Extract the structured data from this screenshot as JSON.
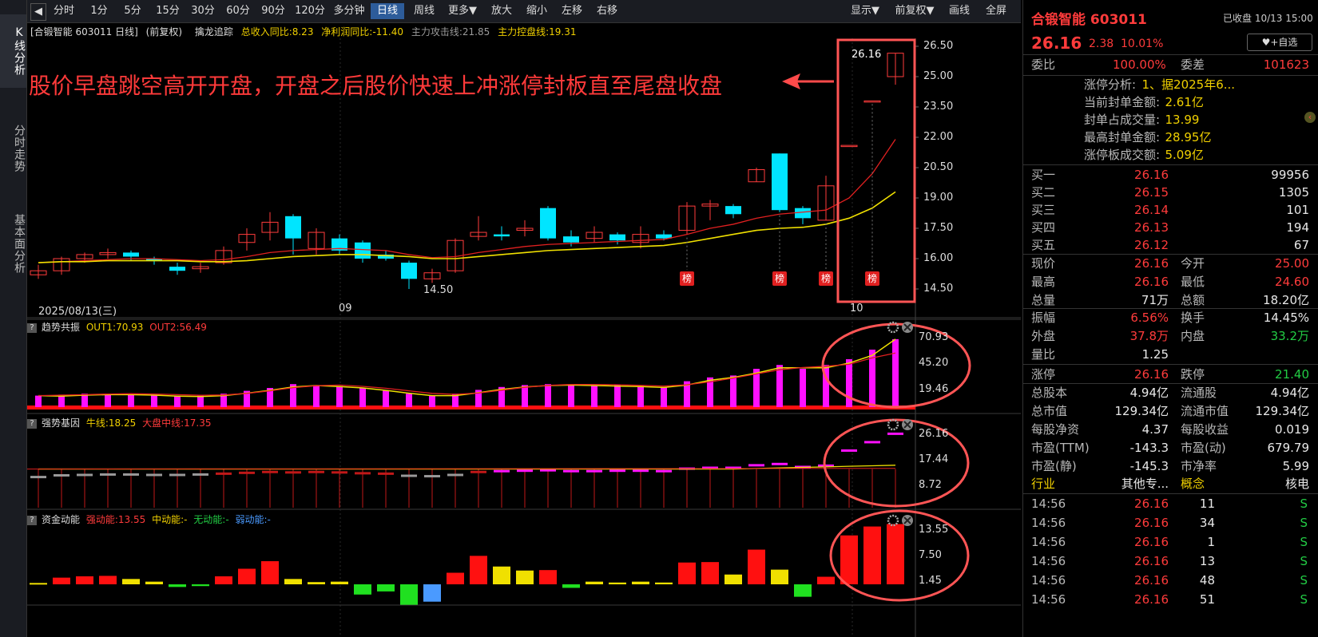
{
  "left_tabs": [
    "K线分析",
    "分时走势",
    "基本面分析"
  ],
  "toolbar": {
    "items": [
      "分时",
      "1分",
      "5分",
      "15分",
      "30分",
      "60分",
      "90分",
      "120分",
      "多分钟",
      "日线",
      "周线",
      "更多▼",
      "放大",
      "缩小",
      "左移",
      "右移"
    ],
    "right_items": [
      "显示▼",
      "前复权▼",
      "画线",
      "全屏"
    ],
    "selected": "日线"
  },
  "info_bar": {
    "title": "[合锻智能 603011 日线]",
    "adj": "(前复权)",
    "indicator": "擒龙追踪",
    "revenue": "总收入同比:8.23",
    "profit": "净利润同比:-11.40",
    "attack": "主力攻击线:21.85",
    "control": "主力控盘线:19.31"
  },
  "annotation": "股价早盘跳空高开开盘，开盘之后股价快速上冲涨停封板直至尾盘收盘",
  "main_chart": {
    "y_ticks": [
      "26.50",
      "25.00",
      "23.50",
      "22.00",
      "20.50",
      "19.00",
      "17.50",
      "16.00",
      "14.50"
    ],
    "last_price_label": "26.16",
    "low_label": "14.50",
    "date_labels": [
      "2025/08/13(三)",
      "09",
      "10"
    ],
    "badge_text": "榜"
  },
  "panel1": {
    "name": "趋势共振",
    "out1": "OUT1:70.93",
    "out2": "OUT2:56.49",
    "ticks": [
      "70.93",
      "45.20",
      "19.46"
    ]
  },
  "panel2": {
    "name": "强势基因",
    "bull": "牛线:18.25",
    "market": "大盘中线:17.35",
    "ticks": [
      "26.16",
      "17.44",
      "8.72"
    ]
  },
  "panel3": {
    "name": "资金动能",
    "strong": "强动能:13.55",
    "mid": "中动能:-",
    "none": "无动能:-",
    "weak": "弱动能:-",
    "ticks": [
      "13.55",
      "7.50",
      "1.45"
    ]
  },
  "chart_data": {
    "type": "candlestick",
    "candles": [
      {
        "o": 15.2,
        "h": 15.7,
        "l": 15.0,
        "c": 15.4
      },
      {
        "o": 15.4,
        "h": 16.1,
        "l": 15.2,
        "c": 16.0
      },
      {
        "o": 16.0,
        "h": 16.3,
        "l": 15.8,
        "c": 16.2
      },
      {
        "o": 16.2,
        "h": 16.5,
        "l": 16.0,
        "c": 16.3
      },
      {
        "o": 16.3,
        "h": 16.4,
        "l": 15.9,
        "c": 16.1
      },
      {
        "o": 16.0,
        "h": 16.1,
        "l": 15.7,
        "c": 15.9
      },
      {
        "o": 15.6,
        "h": 15.8,
        "l": 15.2,
        "c": 15.4
      },
      {
        "o": 15.5,
        "h": 15.8,
        "l": 15.3,
        "c": 15.6
      },
      {
        "o": 15.8,
        "h": 16.6,
        "l": 15.7,
        "c": 16.4
      },
      {
        "o": 16.8,
        "h": 17.5,
        "l": 16.4,
        "c": 17.2
      },
      {
        "o": 17.3,
        "h": 18.3,
        "l": 16.9,
        "c": 17.8
      },
      {
        "o": 18.1,
        "h": 18.2,
        "l": 16.2,
        "c": 17.0
      },
      {
        "o": 16.5,
        "h": 17.5,
        "l": 16.2,
        "c": 17.3
      },
      {
        "o": 17.0,
        "h": 17.2,
        "l": 16.2,
        "c": 16.4
      },
      {
        "o": 16.8,
        "h": 16.9,
        "l": 15.8,
        "c": 16.0
      },
      {
        "o": 16.2,
        "h": 16.4,
        "l": 15.9,
        "c": 16.0
      },
      {
        "o": 15.8,
        "h": 15.9,
        "l": 14.5,
        "c": 15.0
      },
      {
        "o": 15.0,
        "h": 15.5,
        "l": 14.8,
        "c": 15.3
      },
      {
        "o": 15.4,
        "h": 17.0,
        "l": 15.3,
        "c": 16.9
      },
      {
        "o": 17.1,
        "h": 18.1,
        "l": 16.9,
        "c": 17.3
      },
      {
        "o": 17.2,
        "h": 17.6,
        "l": 16.9,
        "c": 17.1
      },
      {
        "o": 17.4,
        "h": 17.9,
        "l": 17.1,
        "c": 17.5
      },
      {
        "o": 18.5,
        "h": 18.6,
        "l": 16.9,
        "c": 17.0
      },
      {
        "o": 17.1,
        "h": 17.4,
        "l": 16.6,
        "c": 16.8
      },
      {
        "o": 17.0,
        "h": 17.6,
        "l": 16.8,
        "c": 17.3
      },
      {
        "o": 17.2,
        "h": 17.3,
        "l": 16.7,
        "c": 16.9
      },
      {
        "o": 16.8,
        "h": 17.6,
        "l": 16.5,
        "c": 17.2
      },
      {
        "o": 17.2,
        "h": 17.4,
        "l": 16.9,
        "c": 17.0
      },
      {
        "o": 17.4,
        "h": 18.8,
        "l": 17.2,
        "c": 18.6
      },
      {
        "o": 18.6,
        "h": 18.9,
        "l": 17.9,
        "c": 18.7
      },
      {
        "o": 18.6,
        "h": 18.7,
        "l": 18.0,
        "c": 18.2
      },
      {
        "o": 19.8,
        "h": 20.5,
        "l": 19.8,
        "c": 20.4
      },
      {
        "o": 21.2,
        "h": 21.2,
        "l": 18.3,
        "c": 18.4
      },
      {
        "o": 18.5,
        "h": 18.6,
        "l": 17.7,
        "c": 18.0
      },
      {
        "o": 17.9,
        "h": 20.1,
        "l": 17.9,
        "c": 19.6
      },
      {
        "o": 21.6,
        "h": 21.6,
        "l": 21.6,
        "c": 21.6
      },
      {
        "o": 23.8,
        "h": 23.8,
        "l": 23.8,
        "c": 23.8
      },
      {
        "o": 25.0,
        "h": 26.16,
        "l": 24.6,
        "c": 26.16
      }
    ],
    "ma_red": [
      15.8,
      15.85,
      15.9,
      15.95,
      16.0,
      16.0,
      15.95,
      15.9,
      15.95,
      16.1,
      16.3,
      16.4,
      16.45,
      16.5,
      16.45,
      16.4,
      16.2,
      16.05,
      16.1,
      16.3,
      16.45,
      16.6,
      16.7,
      16.75,
      16.8,
      16.85,
      16.9,
      16.95,
      17.2,
      17.5,
      17.7,
      18.0,
      18.2,
      18.3,
      18.4,
      19.0,
      20.2,
      21.9
    ],
    "ma_yellow": [
      15.8,
      15.85,
      15.85,
      15.9,
      15.9,
      15.9,
      15.9,
      15.85,
      15.85,
      15.9,
      16.0,
      16.1,
      16.15,
      16.2,
      16.2,
      16.15,
      16.1,
      16.0,
      16.0,
      16.1,
      16.2,
      16.3,
      16.4,
      16.45,
      16.5,
      16.55,
      16.6,
      16.65,
      16.8,
      17.0,
      17.2,
      17.4,
      17.5,
      17.55,
      17.7,
      18.0,
      18.5,
      19.3
    ],
    "trend_bars": [
      12,
      13,
      14,
      14,
      14,
      13,
      12,
      12,
      14,
      17,
      20,
      24,
      23,
      22,
      20,
      17,
      14,
      12,
      14,
      18,
      21,
      23,
      24,
      24,
      23,
      23,
      22,
      21,
      27,
      31,
      33,
      40,
      44,
      40,
      44,
      50,
      60,
      70.93
    ],
    "gene_bars": [
      15.2,
      15.6,
      15.7,
      15.8,
      15.8,
      15.7,
      15.7,
      15.8,
      16.0,
      16.2,
      16.4,
      16.3,
      16.4,
      16.3,
      16.1,
      16.0,
      15.5,
      15.4,
      15.7,
      16.4,
      16.6,
      16.7,
      16.8,
      16.6,
      16.6,
      16.7,
      16.7,
      16.6,
      17.2,
      17.4,
      17.4,
      18.0,
      18.3,
      17.6,
      17.9,
      21.5,
      23.5,
      25.5
    ],
    "fund_bars": [
      0.3,
      1.5,
      1.8,
      1.9,
      1.2,
      0.6,
      -0.6,
      -0.4,
      1.8,
      3.5,
      5.2,
      1.2,
      0.5,
      0.6,
      -2.3,
      -1.6,
      -4.6,
      -3.9,
      2.6,
      6.4,
      4.0,
      3.1,
      3.2,
      -0.8,
      0.6,
      0.4,
      0.6,
      0.4,
      4.9,
      5.0,
      2.2,
      7.8,
      3.3,
      -2.8,
      1.7,
      11.0,
      13.0,
      13.55
    ]
  },
  "right_panel": {
    "stock_name": "合锻智能 603011",
    "status": "已收盘 10/13 15:00",
    "price": "26.16",
    "change": "2.38",
    "change_pct": "10.01%",
    "watch_btn": "♥+自选",
    "weibi_label": "委比",
    "weibi": "100.00%",
    "weicha_label": "委差",
    "weicha": "101623",
    "limit_info": [
      {
        "label": "涨停分析:",
        "value": "1、据2025年6..."
      },
      {
        "label": "当前封单金额:",
        "value": "2.61亿"
      },
      {
        "label": "封单占成交量:",
        "value": "13.99"
      },
      {
        "label": "最高封单金额:",
        "value": "28.95亿"
      },
      {
        "label": "涨停板成交额:",
        "value": "5.09亿"
      }
    ],
    "bids": [
      {
        "label": "买一",
        "price": "26.16",
        "vol": "99956"
      },
      {
        "label": "买二",
        "price": "26.15",
        "vol": "1305"
      },
      {
        "label": "买三",
        "price": "26.14",
        "vol": "101"
      },
      {
        "label": "买四",
        "price": "26.13",
        "vol": "194"
      },
      {
        "label": "买五",
        "price": "26.12",
        "vol": "67"
      }
    ],
    "stats1": [
      {
        "l1": "现价",
        "v1": "26.16",
        "c1": "red",
        "l2": "今开",
        "v2": "25.00",
        "c2": "red"
      },
      {
        "l1": "最高",
        "v1": "26.16",
        "c1": "red",
        "l2": "最低",
        "v2": "24.60",
        "c2": "red"
      },
      {
        "l1": "总量",
        "v1": "71万",
        "c1": "wht",
        "l2": "总额",
        "v2": "18.20亿",
        "c2": "wht"
      }
    ],
    "stats2": [
      {
        "l1": "振幅",
        "v1": "6.56%",
        "c1": "red",
        "l2": "换手",
        "v2": "14.45%",
        "c2": "wht"
      },
      {
        "l1": "外盘",
        "v1": "37.8万",
        "c1": "red",
        "l2": "内盘",
        "v2": "33.2万",
        "c2": "grn"
      },
      {
        "l1": "量比",
        "v1": "1.25",
        "c1": "wht",
        "l2": "",
        "v2": "",
        "c2": "wht"
      }
    ],
    "limit_row": {
      "l1": "涨停",
      "v1": "26.16",
      "l2": "跌停",
      "v2": "21.40"
    },
    "stats3": [
      {
        "l1": "总股本",
        "v1": "4.94亿",
        "l2": "流通股",
        "v2": "4.94亿"
      },
      {
        "l1": "总市值",
        "v1": "129.34亿",
        "l2": "流通市值",
        "v2": "129.34亿"
      },
      {
        "l1": "每股净资",
        "v1": "4.37",
        "l2": "每股收益",
        "v2": "0.019"
      },
      {
        "l1": "市盈(TTM)",
        "v1": "-143.3",
        "l2": "市盈(动)",
        "v2": "679.79"
      },
      {
        "l1": "市盈(静)",
        "v1": "-145.3",
        "l2": "市净率",
        "v2": "5.99"
      }
    ],
    "industry": {
      "l1": "行业",
      "v1": "其他专...",
      "l2": "概念",
      "v2": "核电"
    },
    "ticks": [
      {
        "time": "14:56",
        "price": "26.16",
        "vol": "11",
        "side": "S"
      },
      {
        "time": "14:56",
        "price": "26.16",
        "vol": "34",
        "side": "S"
      },
      {
        "time": "14:56",
        "price": "26.16",
        "vol": "1",
        "side": "S"
      },
      {
        "time": "14:56",
        "price": "26.16",
        "vol": "13",
        "side": "S"
      },
      {
        "time": "14:56",
        "price": "26.16",
        "vol": "48",
        "side": "S"
      },
      {
        "time": "14:56",
        "price": "26.16",
        "vol": "51",
        "side": "S"
      }
    ]
  }
}
